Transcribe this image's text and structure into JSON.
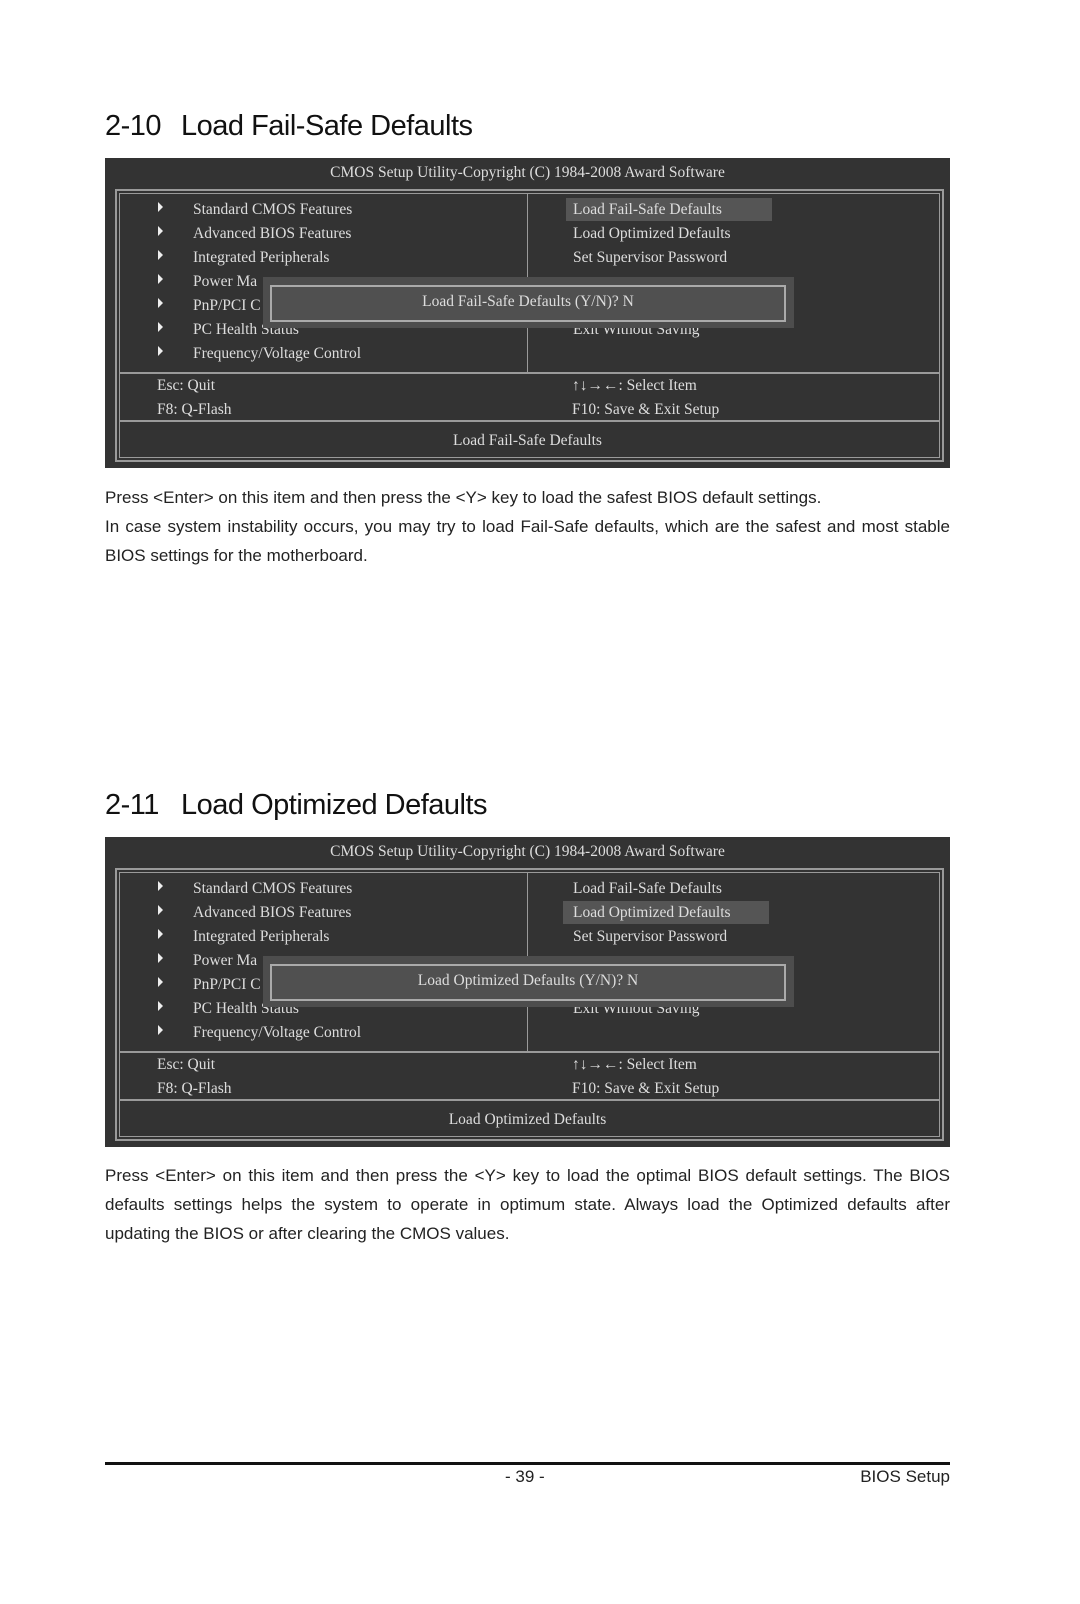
{
  "sections": [
    {
      "number": "2-10",
      "title": "Load Fail-Safe Defaults",
      "bios": {
        "header": "CMOS Setup Utility-Copyright (C) 1984-2008 Award Software",
        "left_menu": [
          "Standard CMOS Features",
          "Advanced BIOS Features",
          "Integrated Peripherals",
          "Power Ma",
          "PnP/PCI C",
          "PC Health Status",
          "Frequency/Voltage Control"
        ],
        "right_menu": [
          "Load Fail-Safe Defaults",
          "Load Optimized Defaults",
          "Set Supervisor Password",
          "",
          "",
          "Exit Without Saving"
        ],
        "selected_index": 0,
        "keys": {
          "esc": "Esc: Quit",
          "f8": "F8: Q-Flash",
          "arrows": "↑↓→←: Select Item",
          "f10": "F10: Save & Exit Setup"
        },
        "status": "Load Fail-Safe Defaults",
        "dialog": "Load Fail-Safe Defaults (Y/N)? N"
      },
      "paragraphs": [
        "Press <Enter> on this item and then press the <Y> key to load the safest BIOS default settings.",
        "In case system instability occurs, you may try to load Fail-Safe defaults, which are the safest and most stable BIOS settings for the motherboard."
      ]
    },
    {
      "number": "2-11",
      "title": "Load Optimized Defaults",
      "bios": {
        "header": "CMOS Setup Utility-Copyright (C) 1984-2008 Award Software",
        "left_menu": [
          "Standard CMOS Features",
          "Advanced BIOS Features",
          "Integrated Peripherals",
          "Power Ma",
          "PnP/PCI C",
          "PC Health Status",
          "Frequency/Voltage Control"
        ],
        "right_menu": [
          "Load Fail-Safe Defaults",
          "Load Optimized Defaults",
          "Set Supervisor Password",
          "",
          "",
          "Exit Without Saving"
        ],
        "selected_index": 1,
        "keys": {
          "esc": "Esc: Quit",
          "f8": "F8: Q-Flash",
          "arrows": "↑↓→←: Select Item",
          "f10": "F10: Save & Exit Setup"
        },
        "status": "Load Optimized Defaults",
        "dialog": "Load Optimized Defaults (Y/N)? N"
      },
      "paragraphs": [
        "Press <Enter> on this item and then press the <Y> key to load the optimal BIOS default settings. The BIOS defaults settings helps the system to operate in optimum state. Always load the Optimized defaults after updating the BIOS or after clearing the CMOS values."
      ]
    }
  ],
  "footer": {
    "page": "- 39 -",
    "section": "BIOS Setup"
  }
}
